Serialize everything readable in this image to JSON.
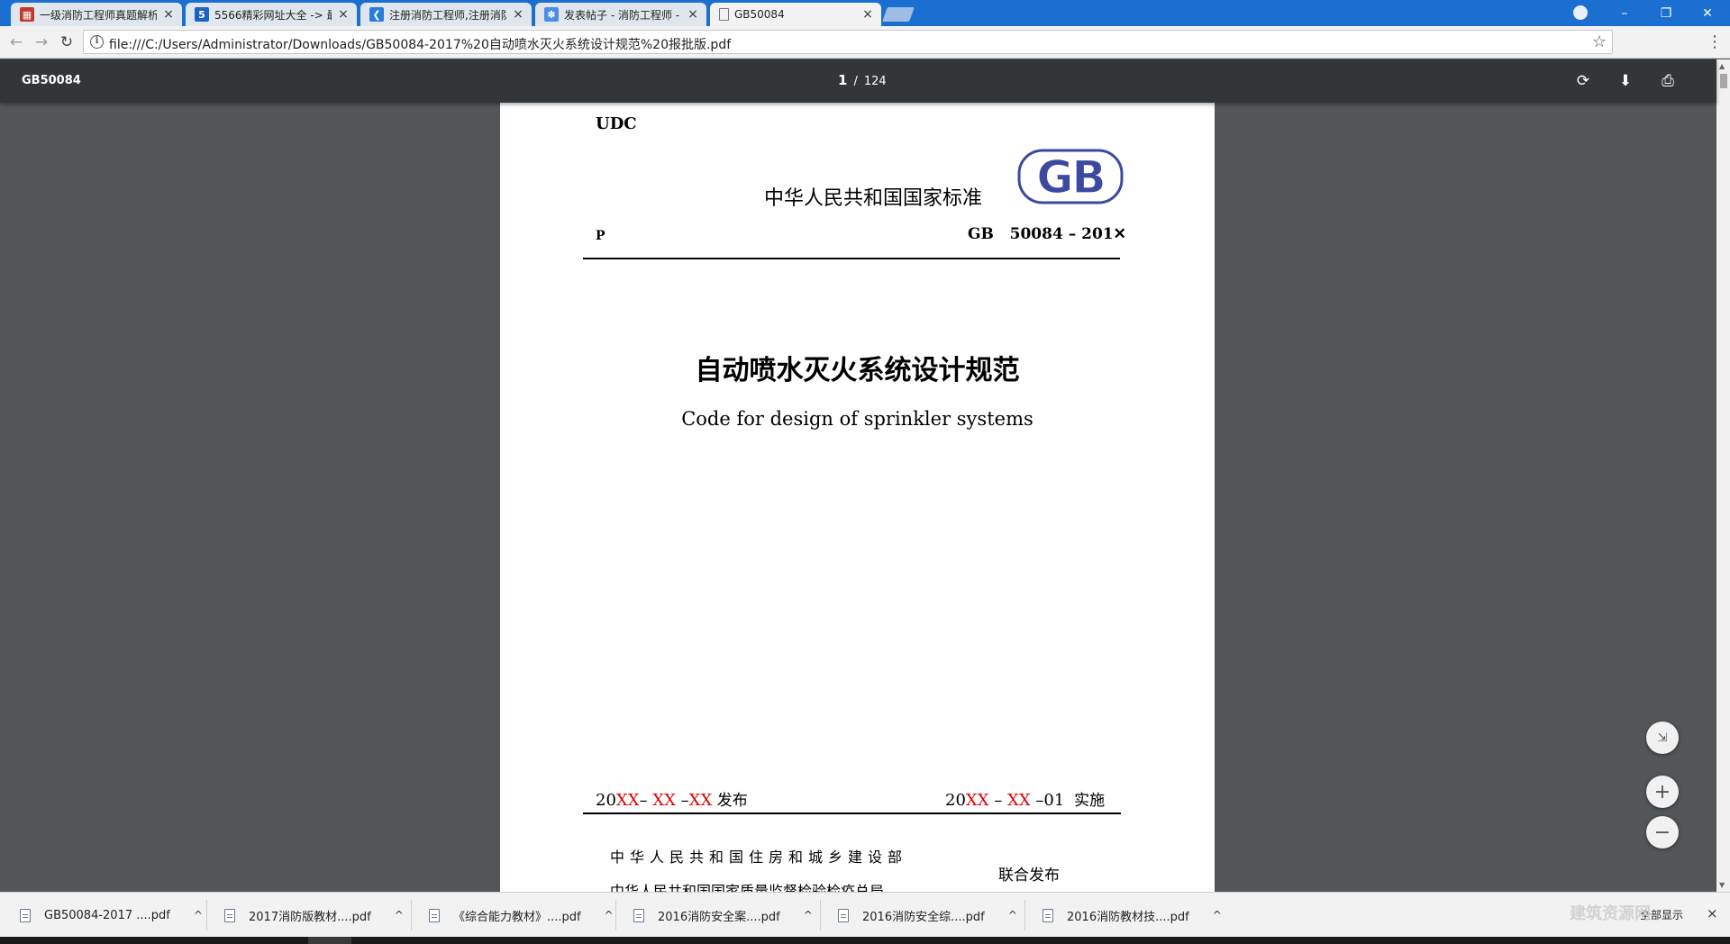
{
  "tabs": [
    {
      "title": "一级消防工程师真题解析",
      "icon": "site-favicon-red",
      "close": "×"
    },
    {
      "title": "5566精彩网址大全 -> 最",
      "icon": "5566-favicon",
      "icon_text": "5",
      "close": "×"
    },
    {
      "title": "注册消防工程师,注册消防",
      "icon": "site-favicon-blue",
      "close": "×"
    },
    {
      "title": "发表帖子 - 消防工程师 -",
      "icon": "forum-favicon",
      "close": "×"
    },
    {
      "title": "GB50084",
      "icon": "document-icon",
      "close": "×",
      "active": true
    }
  ],
  "window_controls": {
    "minimize": "–",
    "restore": "❐",
    "close": "✕"
  },
  "address_bar": {
    "url": "file:///C:/Users/Administrator/Downloads/GB50084-2017%20自动喷水灭火系统设计规范%20报批版.pdf"
  },
  "pdf_toolbar": {
    "title": "GB50084",
    "current_page": "1",
    "separator": "/",
    "total_pages": "124"
  },
  "document": {
    "udc": "UDC",
    "standard_type": "中华人民共和国国家标准",
    "logo_text": "GB",
    "p_label": "P",
    "standard_number": "GB   50084 – 201✕",
    "title_cn": "自动喷水灭火系统设计规范",
    "title_en": "Code for design of sprinkler systems",
    "issue_date": {
      "prefix": "20",
      "yy": "XX",
      "dash1": "– ",
      "mm": "XX",
      "dash2": " –",
      "dd": "XX",
      "label": " 发布"
    },
    "implement_date": {
      "prefix": "20",
      "yy": "XX",
      "dash1": " – ",
      "mm": "XX",
      "suffix": " –01",
      "label": "  实施"
    },
    "publisher_1": "中华人民共和国住房和城乡建设部",
    "publisher_2": "中华人民共和国国家质量监督检验检疫总局",
    "joint_publish": "联合发布"
  },
  "zoom_controls": {
    "fit": "⇲",
    "zoom_in": "+",
    "zoom_out": "−"
  },
  "downloads": [
    {
      "name": "GB50084-2017 ....pdf",
      "caret": "^"
    },
    {
      "name": "2017消防版教材....pdf",
      "caret": "^"
    },
    {
      "name": "《综合能力教材》....pdf",
      "caret": "^"
    },
    {
      "name": "2016消防安全案....pdf",
      "caret": "^"
    },
    {
      "name": "2016消防安全综....pdf",
      "caret": "^"
    },
    {
      "name": "2016消防教材技....pdf",
      "caret": "^"
    }
  ],
  "shelf": {
    "show_all": "全部显示",
    "close": "×"
  },
  "watermark": "建筑资源网",
  "colors": {
    "title_bar": "#1a6fd0",
    "pdf_toolbar": "#323639",
    "viewer_bg": "#525659",
    "date_red": "#e00000",
    "gb_logo": "#3b4aa0"
  }
}
